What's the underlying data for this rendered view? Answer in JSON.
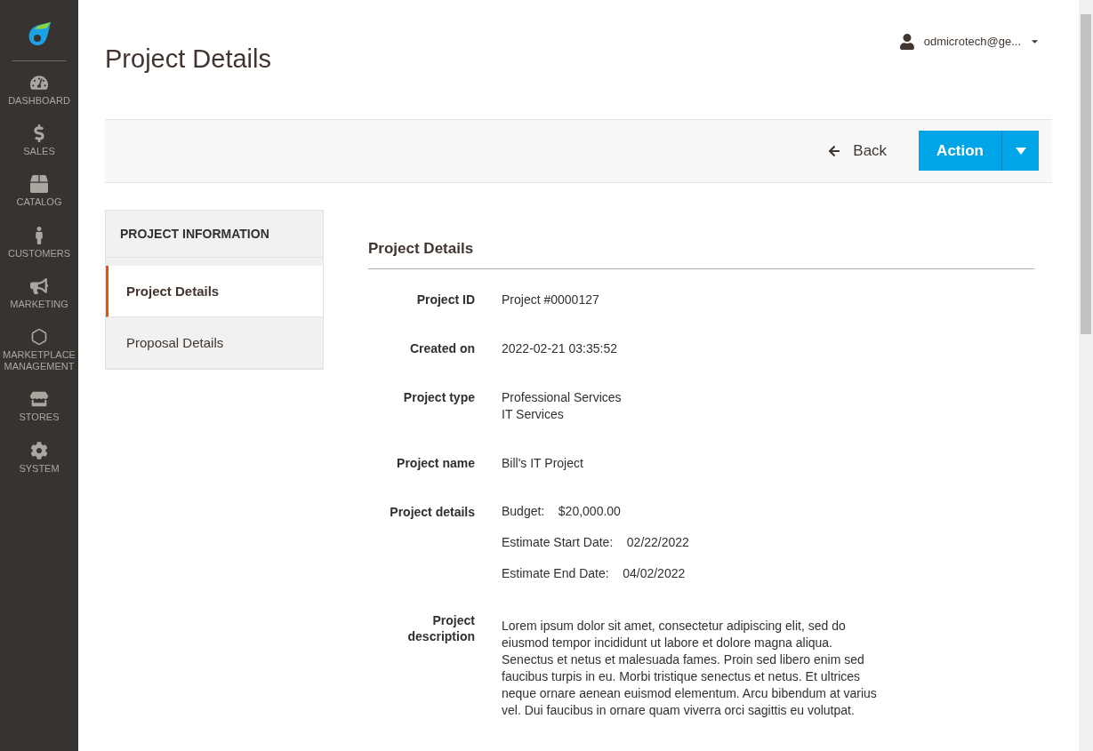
{
  "sidebar": {
    "items": [
      {
        "label": "DASHBOARD"
      },
      {
        "label": "SALES"
      },
      {
        "label": "CATALOG"
      },
      {
        "label": "CUSTOMERS"
      },
      {
        "label": "MARKETING"
      },
      {
        "label": "MARKETPLACE MANAGEMENT"
      },
      {
        "label": "STORES"
      },
      {
        "label": "SYSTEM"
      }
    ]
  },
  "page_title": "Project Details",
  "user": {
    "name": "odmicrotech@ge..."
  },
  "toolbar": {
    "back": "Back",
    "action": "Action"
  },
  "tabs": {
    "title": "PROJECT INFORMATION",
    "items": [
      {
        "label": "Project Details",
        "selected": true
      },
      {
        "label": "Proposal Details",
        "selected": false
      }
    ]
  },
  "section": {
    "title": "Project Details",
    "fields": [
      {
        "label": "Project ID",
        "lines": [
          "Project #0000127"
        ]
      },
      {
        "label": "Created on",
        "lines": [
          "2022-02-21 03:35:52"
        ]
      },
      {
        "label": "Project type",
        "lines": [
          "Professional Services",
          "IT Services"
        ]
      },
      {
        "label": "Project name",
        "lines": [
          "Bill's IT Project"
        ]
      },
      {
        "label": "Project details",
        "pairs": [
          {
            "key": "Budget:",
            "value": "$20,000.00"
          },
          {
            "key": "Estimate Start Date:",
            "value": "02/22/2022"
          },
          {
            "key": "Estimate End Date:",
            "value": "04/02/2022"
          }
        ]
      },
      {
        "label": "Project description",
        "paragraph": "Lorem ipsum dolor sit amet, consectetur adipiscing elit, sed do eiusmod tempor incididunt ut labore et dolore magna aliqua. Senectus et netus et malesuada fames. Proin sed libero enim sed faucibus turpis in eu. Morbi tristique senectus et netus. Et ultrices neque ornare aenean euismod elementum. Arcu bibendum at varius vel. Dui faucibus in ornare quam viverra orci sagittis eu volutpat."
      }
    ]
  }
}
